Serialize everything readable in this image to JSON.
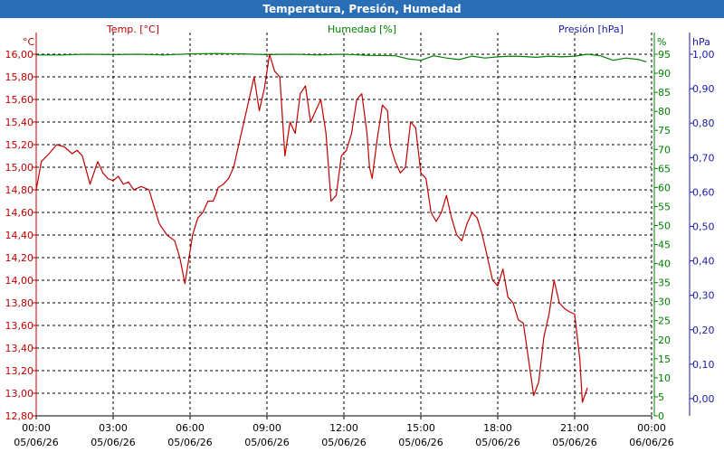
{
  "window": {
    "title": "Temperatura, Presión, Humedad"
  },
  "colors": {
    "title_bar": "#2a6fb5",
    "temperature": "#c00000",
    "humidity": "#008000",
    "pressure": "#1a1aa6",
    "grid": "#000000"
  },
  "chart_data": {
    "type": "line",
    "title": "Temperatura, Presión, Humedad",
    "grid": "dashed",
    "series": [
      {
        "name": "Temp. [°C]",
        "axis": "left",
        "unit": "°C",
        "ylim": [
          12.8,
          16.0
        ],
        "x_hours": [
          0,
          0.2,
          0.5,
          0.8,
          1.1,
          1.4,
          1.6,
          1.8,
          2.1,
          2.4,
          2.6,
          2.8,
          3.0,
          3.2,
          3.4,
          3.6,
          3.8,
          4.1,
          4.4,
          4.6,
          4.8,
          5.1,
          5.4,
          5.6,
          5.8,
          6.1,
          6.3,
          6.5,
          6.7,
          6.9,
          7.0,
          7.1,
          7.3,
          7.5,
          7.7,
          7.9,
          8.1,
          8.3,
          8.5,
          8.7,
          8.9,
          9.1,
          9.3,
          9.5,
          9.7,
          9.9,
          10.1,
          10.3,
          10.5,
          10.7,
          10.9,
          11.1,
          11.3,
          11.5,
          11.7,
          11.9,
          12.1,
          12.3,
          12.5,
          12.7,
          12.9,
          13.0,
          13.1,
          13.3,
          13.5,
          13.7,
          13.8,
          14.0,
          14.2,
          14.4,
          14.6,
          14.8,
          15.0,
          15.2,
          15.4,
          15.6,
          15.8,
          16.0,
          16.2,
          16.4,
          16.6,
          16.8,
          17.0,
          17.2,
          17.4,
          17.6,
          17.8,
          18.0,
          18.2,
          18.4,
          18.6,
          18.8,
          19.0,
          19.2,
          19.4,
          19.6,
          19.8,
          20.0,
          20.2,
          20.4,
          20.6,
          20.8,
          21.0,
          21.2,
          21.3,
          21.5,
          21.7,
          21.9,
          22.1,
          22.3,
          22.5,
          22.7,
          22.9,
          23.1,
          23.3,
          23.5,
          23.7,
          23.9
        ],
        "values": [
          14.8,
          15.05,
          15.12,
          15.2,
          15.18,
          15.12,
          15.15,
          15.1,
          14.85,
          15.05,
          14.95,
          14.9,
          14.88,
          14.92,
          14.85,
          14.87,
          14.8,
          14.83,
          14.8,
          14.65,
          14.5,
          14.4,
          14.35,
          14.2,
          13.97,
          14.4,
          14.55,
          14.6,
          14.7,
          14.7,
          14.75,
          14.82,
          14.85,
          14.9,
          15.0,
          15.2,
          15.4,
          15.6,
          15.8,
          15.5,
          15.7,
          16.0,
          15.85,
          15.8,
          15.1,
          15.4,
          15.3,
          15.65,
          15.72,
          15.4,
          15.5,
          15.6,
          15.3,
          14.7,
          14.75,
          15.1,
          15.15,
          15.3,
          15.6,
          15.65,
          15.3,
          15.0,
          14.9,
          15.25,
          15.55,
          15.5,
          15.2,
          15.05,
          14.95,
          15.0,
          15.4,
          15.35,
          14.95,
          14.9,
          14.6,
          14.52,
          14.6,
          14.75,
          14.55,
          14.4,
          14.35,
          14.5,
          14.6,
          14.55,
          14.4,
          14.2,
          14.0,
          13.95,
          14.1,
          13.85,
          13.8,
          13.65,
          13.62,
          13.3,
          12.98,
          13.1,
          13.5,
          13.7,
          14.0,
          13.8,
          13.75,
          13.72,
          13.7,
          13.3,
          12.92,
          13.05
        ],
        "color": "#c00000"
      },
      {
        "name": "Humedad [%]",
        "axis": "right-inner",
        "unit": "%",
        "ylim": [
          0,
          95
        ],
        "x_hours": [
          0,
          1,
          2,
          3,
          4,
          5,
          6,
          7,
          8,
          9,
          10,
          11,
          12,
          13,
          14,
          14.5,
          15,
          15.5,
          16,
          16.5,
          17,
          17.5,
          18,
          18.5,
          19,
          19.5,
          20,
          20.5,
          21,
          21.5,
          22,
          22.5,
          23,
          23.5,
          23.8
        ],
        "values": [
          94.8,
          94.8,
          95.0,
          94.9,
          95.0,
          94.8,
          95.1,
          95.2,
          95.1,
          94.9,
          95.0,
          94.8,
          95.0,
          94.7,
          94.6,
          93.8,
          93.4,
          94.6,
          94.0,
          93.6,
          94.5,
          94.0,
          94.3,
          94.5,
          94.4,
          94.2,
          94.5,
          94.3,
          94.5,
          95.0,
          94.6,
          93.4,
          94.0,
          93.6,
          93.0
        ],
        "color": "#008000"
      },
      {
        "name": "Presión [hPa]",
        "axis": "right-outer",
        "unit": "hPa",
        "ylim": [
          -0.05,
          1.0
        ],
        "x_hours": [],
        "values": [],
        "color": "#1a1aa6"
      }
    ],
    "x_ticks": [
      {
        "time": "00:00",
        "date": "05/06/26"
      },
      {
        "time": "03:00",
        "date": "05/06/26"
      },
      {
        "time": "06:00",
        "date": "05/06/26"
      },
      {
        "time": "09:00",
        "date": "05/06/26"
      },
      {
        "time": "12:00",
        "date": "05/06/26"
      },
      {
        "time": "15:00",
        "date": "05/06/26"
      },
      {
        "time": "18:00",
        "date": "05/06/26"
      },
      {
        "time": "21:00",
        "date": "05/06/26"
      },
      {
        "time": "00:00",
        "date": "06/06/26"
      }
    ],
    "left_unit": "°C",
    "left_ticks": [
      "16,00",
      "15,80",
      "15,60",
      "15,40",
      "15,20",
      "15,00",
      "14,80",
      "14,60",
      "14,40",
      "14,20",
      "14,00",
      "13,80",
      "13,60",
      "13,40",
      "13,20",
      "13,00",
      "12,80"
    ],
    "humidity_unit": "%",
    "humidity_ticks": [
      "95",
      "90",
      "85",
      "80",
      "75",
      "70",
      "65",
      "60",
      "55",
      "50",
      "45",
      "40",
      "35",
      "30",
      "25",
      "20",
      "15",
      "10",
      "5",
      "0"
    ],
    "pressure_unit": "hPa",
    "pressure_ticks": [
      "1,00",
      "0,90",
      "0,80",
      "0,70",
      "0,60",
      "0,50",
      "0,40",
      "0,30",
      "0,20",
      "0,10",
      "0,00"
    ]
  }
}
